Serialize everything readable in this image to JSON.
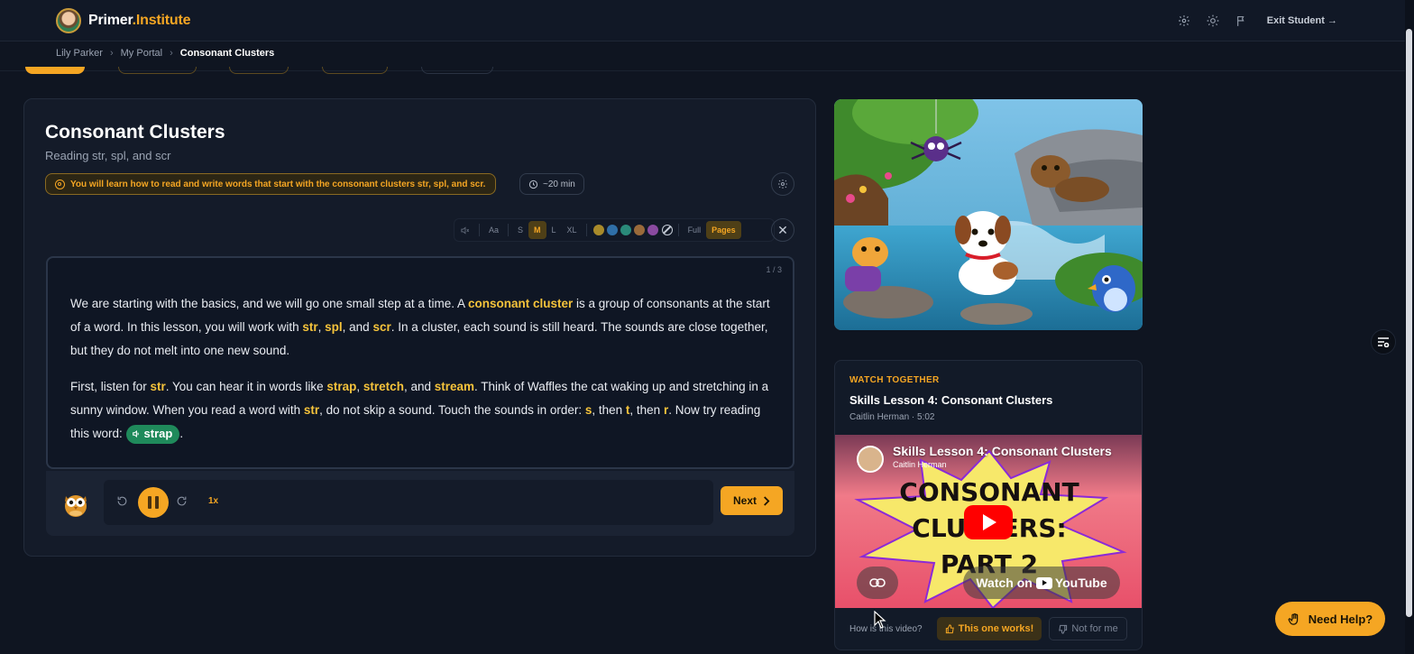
{
  "brand": {
    "name_plain": "Primer",
    "name_accent": ".Institute"
  },
  "header": {
    "exit_label": "Exit Student →"
  },
  "breadcrumb": [
    "Lily Parker",
    "My Portal",
    "Consonant Clusters"
  ],
  "lesson": {
    "title": "Consonant Clusters",
    "subtitle": "Reading str, spl, and scr",
    "objective": "You will learn how to read and write words that start with the consonant clusters str, spl, and scr.",
    "duration": "~20 min",
    "page_count": "1 / 3"
  },
  "toolbar": {
    "font_icon_label": "Aa",
    "sizes": [
      "S",
      "M",
      "L",
      "XL"
    ],
    "selected_size": "M",
    "swatches": [
      "#a88a2a",
      "#2f6fa8",
      "#2a8a7a",
      "#9a6a3a",
      "#8a4aa0"
    ],
    "view_full": "Full",
    "view_pages": "Pages"
  },
  "reading": {
    "p1": [
      {
        "t": "We are starting with the basics, and we will go one small step at a time. A "
      },
      {
        "t": "consonant cluster",
        "hl": true
      },
      {
        "t": " is a group of consonants at the start of a word. In this lesson, you will work with "
      },
      {
        "t": "str",
        "hl": true
      },
      {
        "t": ", "
      },
      {
        "t": "spl",
        "hl": true
      },
      {
        "t": ", and "
      },
      {
        "t": "scr",
        "hl": true
      },
      {
        "t": ". In a cluster, each sound is still heard. The sounds are close together, but they do not melt into one new sound."
      }
    ],
    "p2": [
      {
        "t": "First, listen for "
      },
      {
        "t": "str",
        "hl": true
      },
      {
        "t": ". You can hear it in words like "
      },
      {
        "t": "strap",
        "hl": true
      },
      {
        "t": ", "
      },
      {
        "t": "stretch",
        "hl": true
      },
      {
        "t": ", and "
      },
      {
        "t": "stream",
        "hl": true
      },
      {
        "t": ". Think of Waffles the cat waking up and stretching in a sunny window. When you read a word with "
      },
      {
        "t": "str",
        "hl": true
      },
      {
        "t": ", do not skip a sound. Touch the sounds in order: "
      },
      {
        "t": "s",
        "hl": true
      },
      {
        "t": ", then "
      },
      {
        "t": "t",
        "hl": true
      },
      {
        "t": ", then "
      },
      {
        "t": "r",
        "hl": true
      },
      {
        "t": ". Now try reading this word: "
      }
    ],
    "practice_word": "strap",
    "p2_end": "."
  },
  "player": {
    "speed": "1x",
    "next_label": "Next"
  },
  "video": {
    "eyebrow": "WATCH TOGETHER",
    "title": "Skills Lesson 4: Consonant Clusters",
    "meta": "Caitlin Herman · 5:02",
    "embed_title": "Skills Lesson 4: Consonant Clusters",
    "embed_channel": "Caitlin Herman",
    "thumb_lines": [
      "CONSONANT",
      "CLUSTERS:",
      "PART 2"
    ],
    "watch_on": "Watch on",
    "youtube": "YouTube",
    "feedback_q": "How is this video?",
    "yes_label": "This one works!",
    "no_label": "Not for me"
  },
  "help": {
    "label": "Need Help?"
  },
  "colors": {
    "accent": "#f5a623",
    "highlight": "#f5c33b",
    "chip": "#1f8a5b",
    "bg": "#0f1521"
  }
}
